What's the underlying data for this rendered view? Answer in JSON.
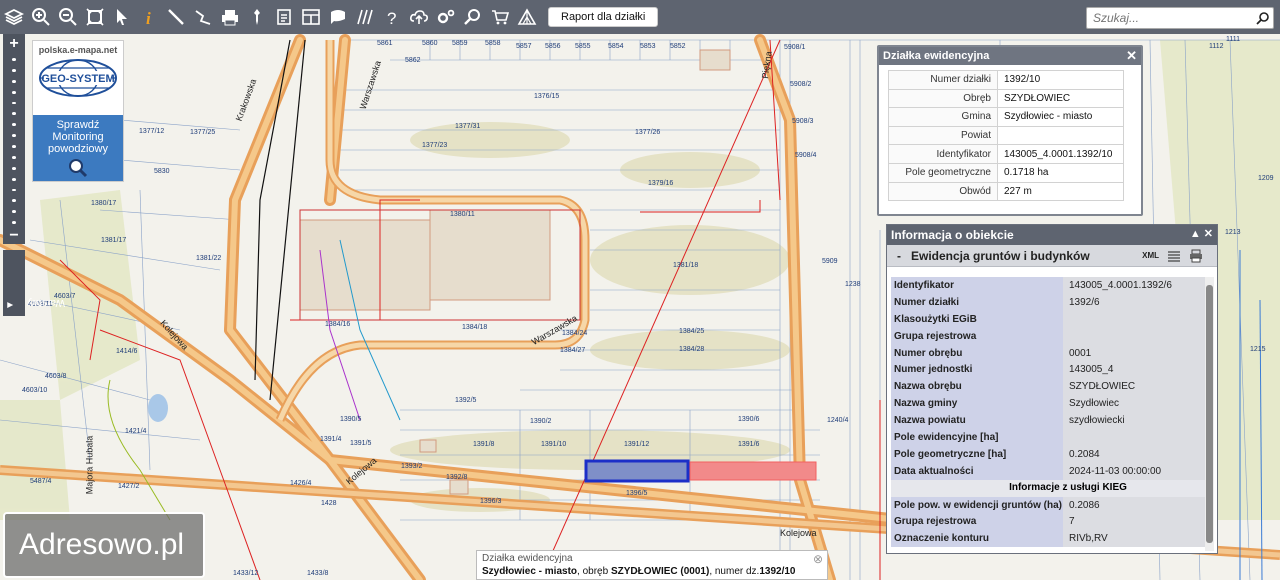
{
  "toolbar": {
    "report_label": "Raport dla działki",
    "search_placeholder": "Szukaj..."
  },
  "side": {
    "zoom_in": "+",
    "zoom_out": "−",
    "layers_label": "Warstwy"
  },
  "logo": {
    "url": "polska.e-mapa.net",
    "brand": "GEO-SYSTEM",
    "monitor_label": "Sprawdź Monitoring powodziowy"
  },
  "parcel_panel": {
    "title": "Działka ewidencyjna",
    "rows": [
      {
        "key": "Numer działki",
        "value": "1392/10"
      },
      {
        "key": "Obręb",
        "value": "SZYDŁOWIEC"
      },
      {
        "key": "Gmina",
        "value": "Szydłowiec - miasto"
      },
      {
        "key": "Powiat",
        "value": ""
      },
      {
        "key": "Identyfikator",
        "value": "143005_4.0001.1392/10"
      },
      {
        "key": "Pole geometryczne",
        "value": "0.1718 ha"
      },
      {
        "key": "Obwód",
        "value": "227 m"
      }
    ]
  },
  "info_panel": {
    "title": "Informacja o obiekcie",
    "section_title": "Ewidencja gruntów i budynków",
    "xml_label": "XML",
    "rows": [
      {
        "key": "Identyfikator",
        "value": "143005_4.0001.1392/6"
      },
      {
        "key": "Numer działki",
        "value": "1392/6"
      },
      {
        "key": "Klasoużytki EGiB",
        "value": ""
      },
      {
        "key": "Grupa rejestrowa",
        "value": ""
      },
      {
        "key": "Numer obrębu",
        "value": "0001"
      },
      {
        "key": "Numer jednostki",
        "value": "143005_4"
      },
      {
        "key": "Nazwa obrębu",
        "value": "SZYDŁOWIEC"
      },
      {
        "key": "Nazwa gminy",
        "value": "Szydłowiec"
      },
      {
        "key": "Nazwa powiatu",
        "value": "szydłowiecki"
      },
      {
        "key": "Pole ewidencyjne [ha]",
        "value": ""
      },
      {
        "key": "Pole geometryczne [ha]",
        "value": "0.2084"
      },
      {
        "key": "Data aktualności",
        "value": "2024-11-03 00:00:00"
      }
    ],
    "kieg_title": "Informacje z usługi KIEG",
    "kieg_rows": [
      {
        "key": "Pole pow. w ewidencji gruntów (ha)",
        "value": "0.2086"
      },
      {
        "key": "Grupa rejestrowa",
        "value": "7"
      },
      {
        "key": "Oznaczenie konturu",
        "value": "RIVb,RV"
      }
    ]
  },
  "bottom_tip": {
    "line1": "Działka ewidencyjna",
    "gmina": "Szydłowiec - miasto",
    "obreb_prefix": ", obręb ",
    "obreb": "SZYDŁOWIEC (0001)",
    "nr_prefix": ", numer dz.",
    "nr": "1392/10"
  },
  "watermark": "Adresowo.pl",
  "map": {
    "streets": [
      "Warszawska",
      "Krakowska",
      "Kolejowa",
      "Piękna",
      "Majora Hubala",
      "Warszawska",
      "Kolejowa",
      "Kolejowa"
    ],
    "parcels": [
      "5861",
      "5860",
      "5859",
      "5858",
      "5857",
      "5856",
      "5855",
      "5854",
      "5853",
      "5852",
      "5862",
      "1376/15",
      "1377/31",
      "1377/23",
      "1377/26",
      "1379/16",
      "1380/11",
      "1381/18",
      "1384/25",
      "1384/28",
      "1384/24",
      "1384/27",
      "1384/18",
      "1390/5",
      "1390/2",
      "1390/6",
      "1391/8",
      "1391/10",
      "1391/12",
      "1391/6",
      "1392/8",
      "1396/5",
      "1396/3",
      "1393/2",
      "1426/4",
      "1428",
      "1433/12",
      "1433/8",
      "5908/1",
      "5908/2",
      "5908/3",
      "5908/4",
      "5909",
      "1377/12",
      "1377/25",
      "5830",
      "1380/17",
      "1381/17",
      "1381/22",
      "4603/7",
      "4603/11",
      "1414/6",
      "4603/8",
      "4603/10",
      "1421/4",
      "5487/4",
      "1427/2",
      "1111",
      "1112",
      "1209",
      "1213",
      "1215",
      "1238",
      "1240/4",
      "1391/5",
      "1391/4",
      "1392/5",
      "1384/16"
    ]
  }
}
